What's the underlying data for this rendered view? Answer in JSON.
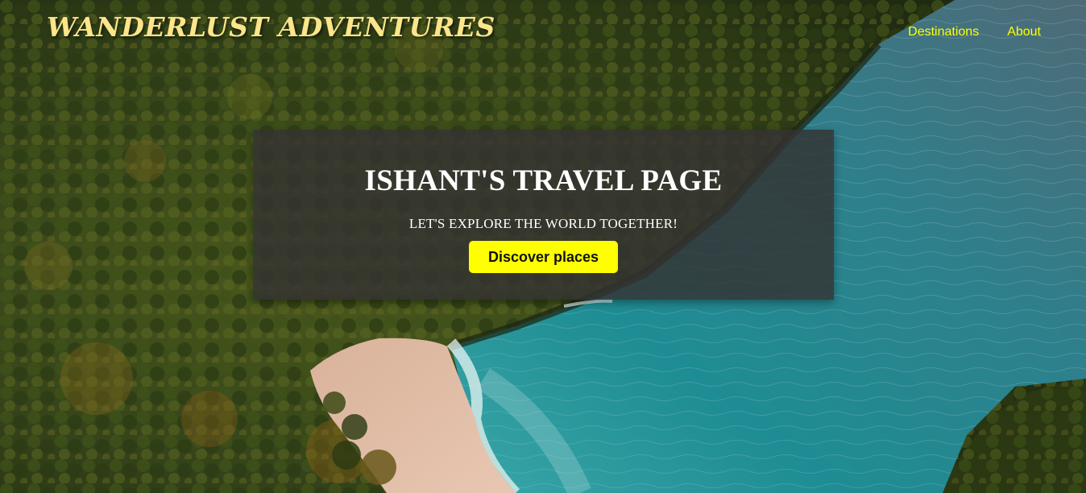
{
  "header": {
    "logo": "WANDERLUST ADVENTURES",
    "nav": [
      {
        "label": "Destinations"
      },
      {
        "label": "About"
      }
    ]
  },
  "hero": {
    "title": "ISHANT'S TRAVEL PAGE",
    "subtitle": "LET'S EXPLORE THE WORLD TOGETHER!",
    "button_label": "Discover places"
  },
  "colors": {
    "logo": "#fce58a",
    "nav_link": "#ffff00",
    "button_bg": "#ffff00",
    "hero_box": "#343232"
  }
}
